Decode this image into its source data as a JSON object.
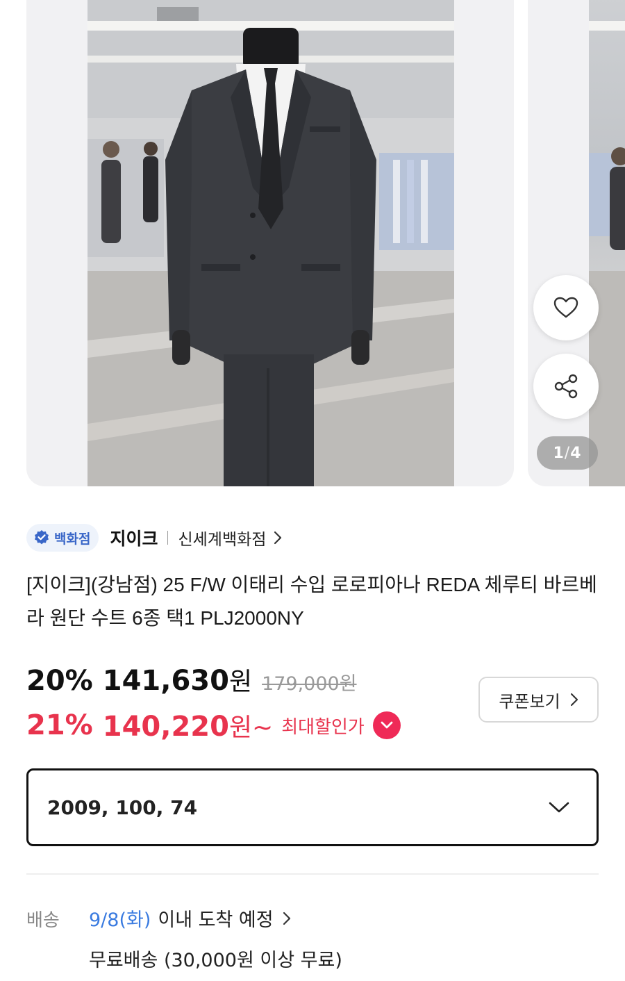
{
  "gallery": {
    "counter_current": "1",
    "counter_total": "4",
    "like_icon": "heart-outline-icon",
    "share_icon": "share-icon"
  },
  "seller": {
    "badge_label": "백화점",
    "brand": "지이크",
    "store": "신세계백화점"
  },
  "product": {
    "title": "[지이크](강남점) 25 F/W 이태리 수입 로로피아나 REDA 체루티 바르베라 원단 수트 6종 택1 PLJ2000NY"
  },
  "price": {
    "discount_pct": "20%",
    "sale_amount": "141,630",
    "won": "원",
    "original": "179,000원",
    "max_discount_pct": "21%",
    "max_amount": "140,220",
    "max_won": "원~",
    "max_label": "최대할인가"
  },
  "coupon": {
    "label": "쿠폰보기"
  },
  "option": {
    "selected": "2009, 100, 74"
  },
  "shipping": {
    "label": "배송",
    "date": "9/8(화)",
    "eta_text": "이내 도착 예정",
    "fee_text": "무료배송 (30,000원 이상 무료)"
  },
  "colors": {
    "accent_red": "#e8334d",
    "badge_blue": "#3a67c8",
    "date_blue": "#3a7be0"
  }
}
